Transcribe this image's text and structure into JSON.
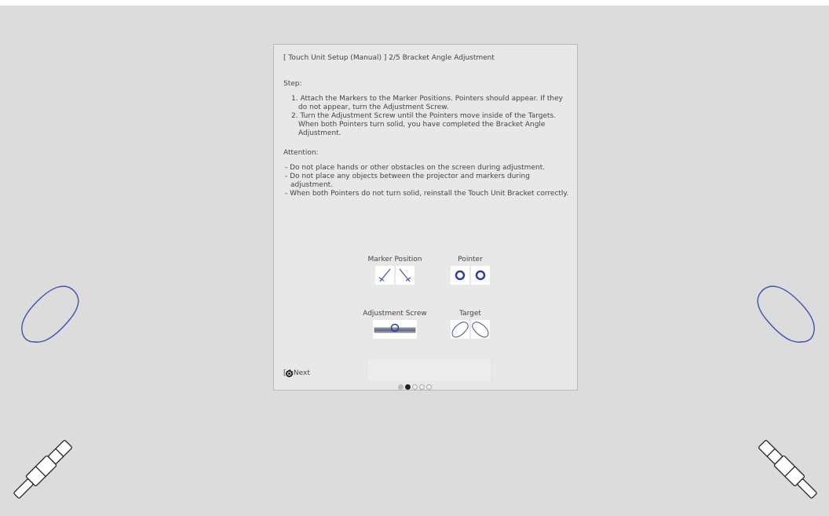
{
  "panel": {
    "title": "[ Touch Unit Setup (Manual) ]  2/5 Bracket Angle Adjustment",
    "step_heading": "Step:",
    "steps": [
      "1. Attach the Markers to the Marker Positions. Pointers should appear. If they do not appear, turn the Adjustment Screw.",
      "2. Turn the Adjustment Screw until the Pointers move inside of the Targets. When both Pointers turn solid, you have completed the Bracket Angle Adjustment."
    ],
    "attention_heading": "Attention:",
    "attention": [
      "- Do not place hands or other obstacles on the screen during adjustment.",
      "- Do not place any objects between the projector and markers during adjustment.",
      "- When both Pointers do not turn solid, reinstall the Touch Unit Bracket correctly."
    ],
    "legend": {
      "marker_position": "Marker Position",
      "pointer": "Pointer",
      "adjustment_screw": "Adjustment Screw",
      "target": "Target"
    },
    "next_label": "[ ]:Next",
    "next_key_icon": "circle-button-icon",
    "pagination": {
      "current": 2,
      "total": 5
    }
  },
  "colors": {
    "background": "#dcdcdc",
    "panel": "#e8e8e8",
    "accent_blue": "#3f54b0",
    "pointer_blue": "#2a3fa0"
  }
}
